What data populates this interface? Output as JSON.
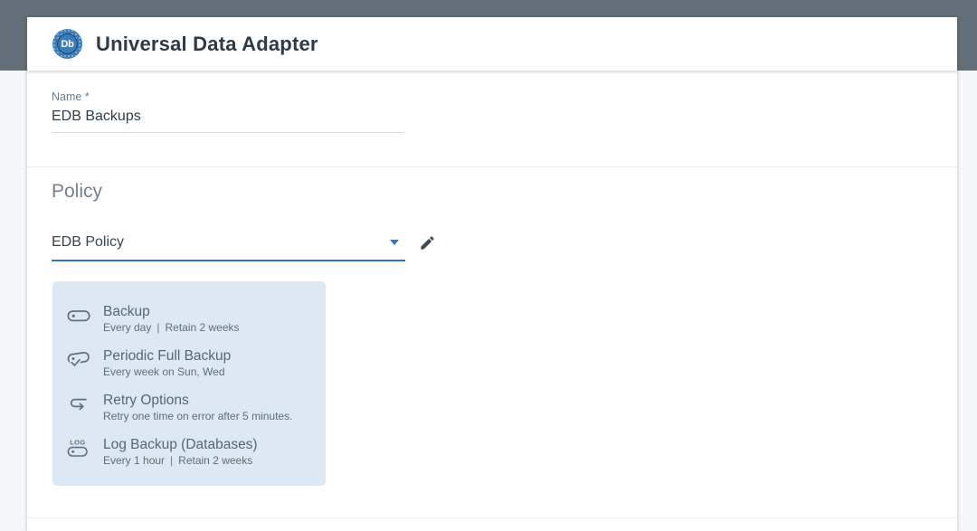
{
  "header": {
    "badge": "Db",
    "title": "Universal Data Adapter"
  },
  "name_field": {
    "label": "Name *",
    "value": "EDB Backups"
  },
  "policy": {
    "heading": "Policy",
    "selected_policy": "EDB Policy",
    "log_icon_text": "LOG",
    "items": [
      {
        "icon": "backup-pill-icon",
        "title": "Backup",
        "schedule": "Every day",
        "separator": "|",
        "retention": "Retain 2 weeks"
      },
      {
        "icon": "periodic-full-backup-icon",
        "title": "Periodic Full Backup",
        "schedule": "Every week on Sun, Wed"
      },
      {
        "icon": "retry-arrow-icon",
        "title": "Retry Options",
        "schedule": "Retry one time on error after 5 minutes."
      },
      {
        "icon": "log-backup-icon",
        "title": "Log Backup (Databases)",
        "schedule": "Every 1 hour",
        "separator": "|",
        "retention": "Retain 2 weeks"
      }
    ]
  },
  "colors": {
    "top_bar": "#626e78",
    "accent_blue": "#2e77c4",
    "badge_blue": "#3b7cbb",
    "summary_card_bg": "#dce8f2"
  }
}
